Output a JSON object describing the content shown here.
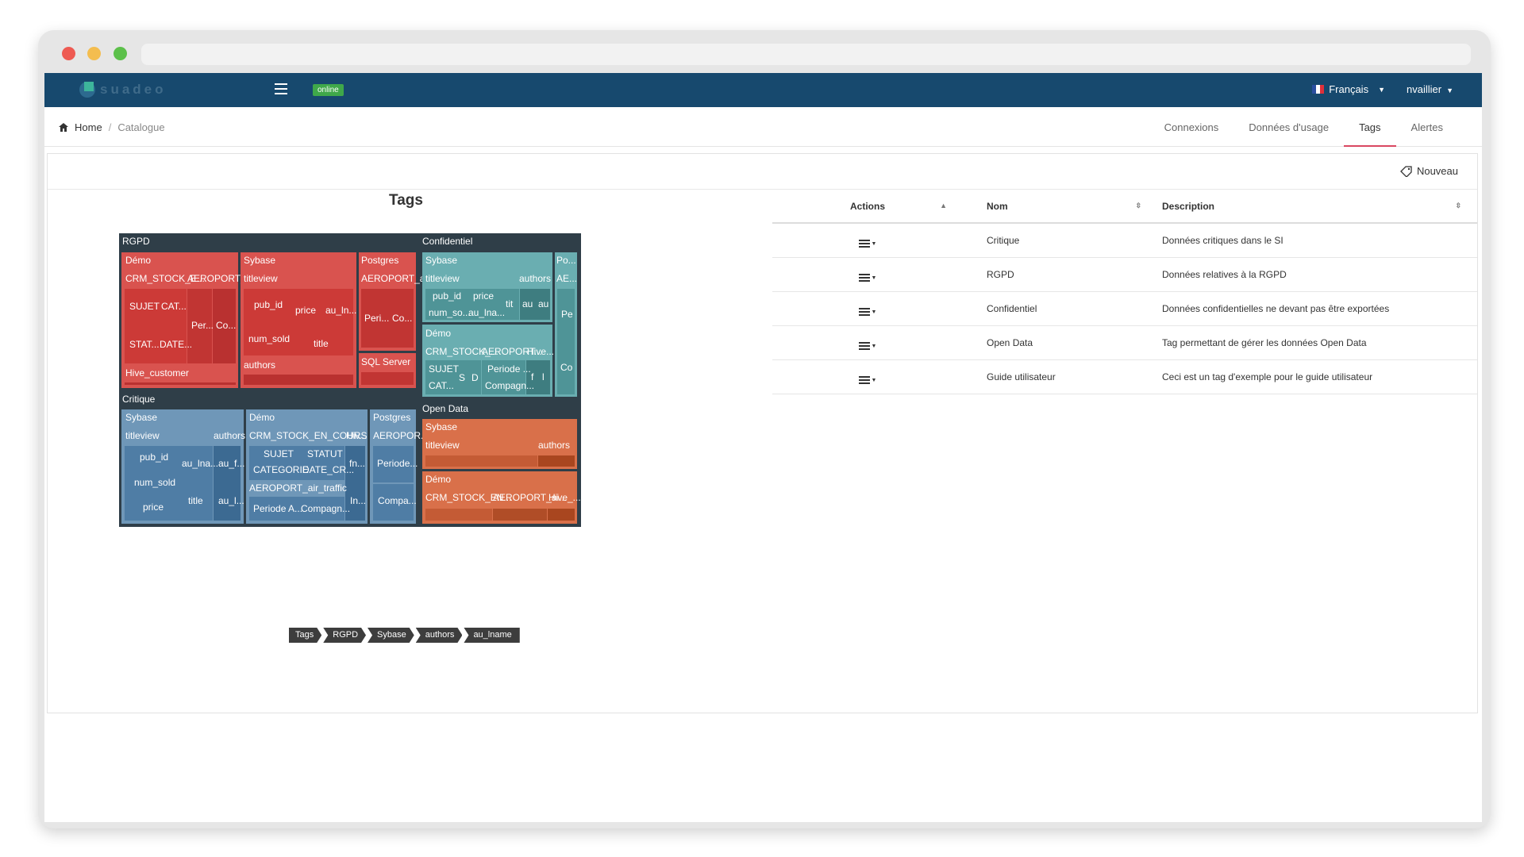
{
  "app": {
    "logo_text": "suadeo",
    "status_badge": "online"
  },
  "topnav": {
    "language": "Français",
    "user": "nvaillier"
  },
  "breadcrumb": {
    "home": "Home",
    "separator": "/",
    "current": "Catalogue"
  },
  "tabs": [
    {
      "label": "Connexions",
      "active": false
    },
    {
      "label": "Données d'usage",
      "active": false
    },
    {
      "label": "Tags",
      "active": true
    },
    {
      "label": "Alertes",
      "active": false
    }
  ],
  "panel": {
    "new_button": "Nouveau",
    "treemap_title": "Tags"
  },
  "treemap": {
    "groups": [
      {
        "label": "RGPD",
        "color": "#d9534f",
        "children": [
          {
            "label": "Démo",
            "children": [
              "CRM_STOCK_E...",
              "AEROPORT_...",
              "SUJET",
              "CAT...",
              "STAT...",
              "DATE...",
              "Per...",
              "Co...",
              "Hive_customer"
            ]
          },
          {
            "label": "Sybase",
            "children": [
              "titleview",
              "pub_id",
              "price",
              "au_ln...",
              "num_sold",
              "title",
              "authors"
            ]
          },
          {
            "label": "Postgres",
            "children": [
              "AEROPORT_a...",
              "Peri...",
              "Co..."
            ]
          },
          {
            "label": "SQL Server",
            "children": []
          }
        ]
      },
      {
        "label": "Confidentiel",
        "color": "#6aaeb1",
        "children": [
          {
            "label": "Sybase",
            "children": [
              "titleview",
              "authors",
              "pub_id",
              "price",
              "num_so...",
              "au_lna...",
              "tit",
              "au",
              "au"
            ]
          },
          {
            "label": "Po...",
            "children": [
              "AE...",
              "Pe",
              "Co"
            ]
          },
          {
            "label": "Démo",
            "children": [
              "CRM_STOCK_...",
              "AEROPORT...",
              "Hive...",
              "SUJET",
              "S",
              "D",
              "Periode ...",
              "CAT...",
              "Compagn...",
              "f",
              "l"
            ]
          }
        ]
      },
      {
        "label": "Critique",
        "color": "#6f97b8",
        "children": [
          {
            "label": "Sybase",
            "children": [
              "titleview",
              "authors",
              "pub_id",
              "au_lna...",
              "au_f...",
              "num_sold",
              "price",
              "title",
              "au_l..."
            ]
          },
          {
            "label": "Démo",
            "children": [
              "CRM_STOCK_EN_COURS",
              "Hiv...",
              "SUJET",
              "STATUT",
              "CATEGORIE",
              "DATE_CR...",
              "fn...",
              "AEROPORT_air_traffic",
              "Periode A...",
              "Compagn...",
              "In..."
            ]
          },
          {
            "label": "Postgres",
            "children": [
              "AEROPOR...",
              "Periode...",
              "Compa..."
            ]
          }
        ]
      },
      {
        "label": "Open Data",
        "color": "#d9704a",
        "children": [
          {
            "label": "Sybase",
            "children": [
              "titleview",
              "authors"
            ]
          },
          {
            "label": "Démo",
            "children": [
              "CRM_STOCK_EN...",
              "AEROPORT_ai...",
              "Hive_..."
            ]
          }
        ]
      }
    ],
    "path": [
      "Tags",
      "RGPD",
      "Sybase",
      "authors",
      "au_lname"
    ]
  },
  "table": {
    "headers": {
      "actions": "Actions",
      "nom": "Nom",
      "description": "Description"
    },
    "rows": [
      {
        "nom": "Critique",
        "description": "Données critiques dans le SI"
      },
      {
        "nom": "RGPD",
        "description": "Données relatives à la RGPD"
      },
      {
        "nom": "Confidentiel",
        "description": "Données confidentielles ne devant pas être exportées"
      },
      {
        "nom": "Open Data",
        "description": "Tag permettant de gérer les données Open Data"
      },
      {
        "nom": "Guide utilisateur",
        "description": "Ceci est un tag d'exemple pour le guide utilisateur"
      }
    ]
  }
}
